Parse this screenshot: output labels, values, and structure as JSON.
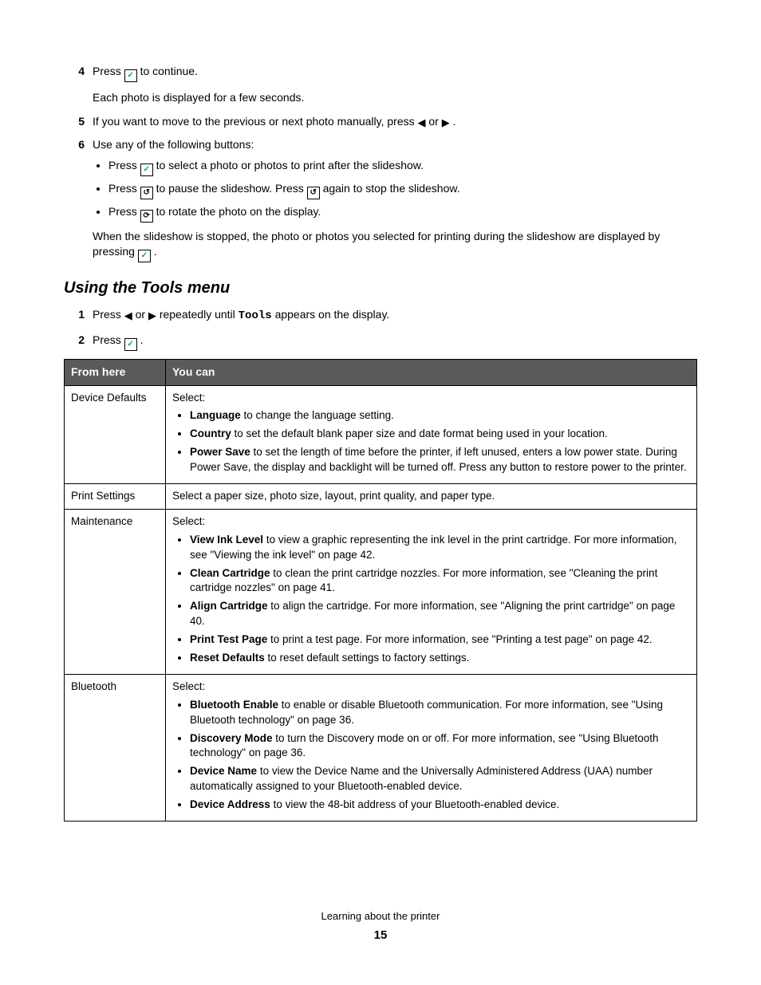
{
  "steps_top": {
    "s4": {
      "num": "4",
      "pre": "Press ",
      "post": " to continue.",
      "after": "Each photo is displayed for a few seconds."
    },
    "s5": {
      "num": "5",
      "pre": "If you want to move to the previous or next photo manually, press ",
      "mid": " or ",
      "post": "."
    },
    "s6": {
      "num": "6",
      "text": "Use any of the following buttons:",
      "b1_pre": "Press ",
      "b1_post": " to select a photo or photos to print after the slideshow.",
      "b2_pre": "Press ",
      "b2_mid": " to pause the slideshow. Press ",
      "b2_post": " again to stop the slideshow.",
      "b3_pre": "Press ",
      "b3_post": " to rotate the photo on the display.",
      "after_pre": "When the slideshow is stopped, the photo or photos you selected for printing during the slideshow are displayed by pressing ",
      "after_post": "."
    }
  },
  "section_heading": "Using the Tools menu",
  "steps_tools": {
    "s1": {
      "num": "1",
      "pre": "Press ",
      "mid": " or ",
      "mid2": " repeatedly until ",
      "tools": "Tools",
      "post": " appears on the display."
    },
    "s2": {
      "num": "2",
      "pre": "Press ",
      "post": "."
    }
  },
  "table": {
    "h1": "From here",
    "h2": "You can",
    "r1": {
      "label": "Device Defaults",
      "intro": "Select:",
      "items": [
        {
          "b": "Language",
          "t": " to change the language setting."
        },
        {
          "b": "Country",
          "t": " to set the default blank paper size and date format being used in your location."
        },
        {
          "b": "Power Save",
          "t": " to set the length of time before the printer, if left unused, enters a low power state. During Power Save, the display and backlight will be turned off. Press any button to restore power to the printer."
        }
      ]
    },
    "r2": {
      "label": "Print Settings",
      "text": "Select a paper size, photo size, layout, print quality, and paper type."
    },
    "r3": {
      "label": "Maintenance",
      "intro": "Select:",
      "items": [
        {
          "b": "View Ink Level",
          "t": " to view a graphic representing the ink level in the print cartridge. For more information, see \"Viewing the ink level\" on page 42."
        },
        {
          "b": "Clean Cartridge",
          "t": " to clean the print cartridge nozzles. For more information, see \"Cleaning the print cartridge nozzles\" on page 41."
        },
        {
          "b": "Align Cartridge",
          "t": " to align the cartridge. For more information, see \"Aligning the print cartridge\" on page 40."
        },
        {
          "b": "Print Test Page",
          "t": " to print a test page. For more information, see \"Printing a test page\" on page 42."
        },
        {
          "b": "Reset Defaults",
          "t": " to reset default settings to factory settings."
        }
      ]
    },
    "r4": {
      "label": "Bluetooth",
      "intro": "Select:",
      "items": [
        {
          "b": "Bluetooth Enable",
          "t": " to enable or disable Bluetooth communication. For more information, see \"Using Bluetooth technology\" on page 36."
        },
        {
          "b": "Discovery Mode",
          "t": " to turn the Discovery mode on or off. For more information, see \"Using Bluetooth technology\" on page 36."
        },
        {
          "b": "Device Name",
          "t": " to view the Device Name and the Universally Administered Address (UAA) number automatically assigned to your Bluetooth-enabled device."
        },
        {
          "b": "Device Address",
          "t": " to view the 48-bit address of your Bluetooth-enabled device."
        }
      ]
    }
  },
  "footer": {
    "text": "Learning about the printer",
    "page": "15"
  }
}
